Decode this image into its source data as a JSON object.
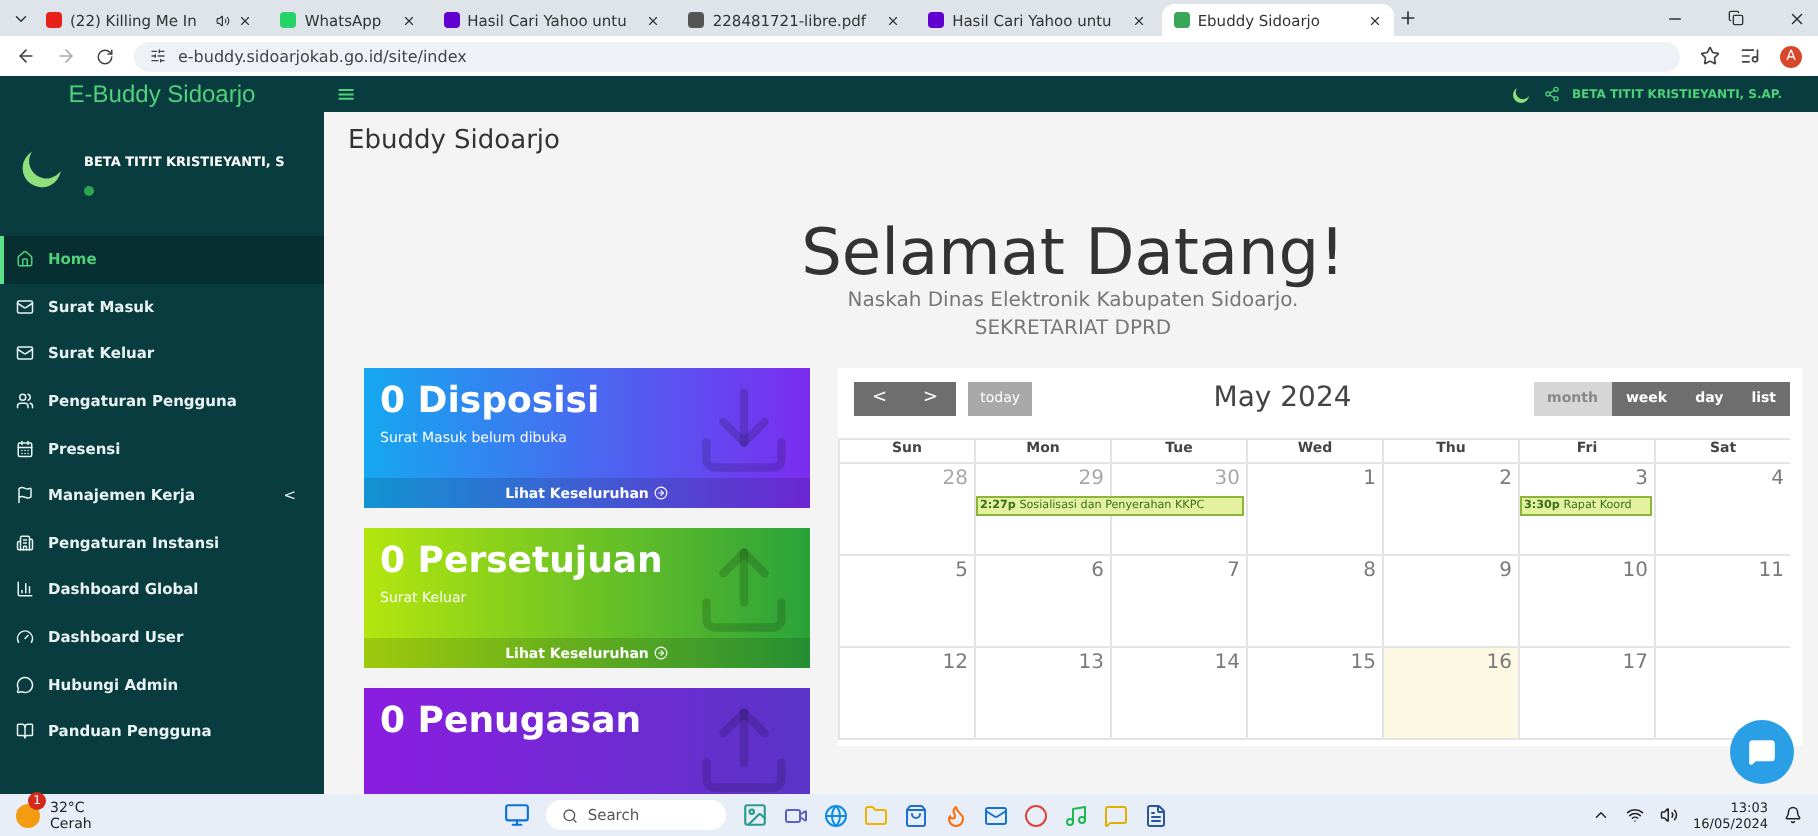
{
  "browser": {
    "tabs": [
      {
        "title": "(22) Killing Me In",
        "selected": false,
        "audio": true
      },
      {
        "title": "WhatsApp",
        "selected": false
      },
      {
        "title": "Hasil Cari Yahoo untu",
        "selected": false
      },
      {
        "title": "228481721-libre.pdf",
        "selected": false
      },
      {
        "title": "Hasil Cari Yahoo untu",
        "selected": false
      },
      {
        "title": "Ebuddy Sidoarjo",
        "selected": true
      }
    ],
    "address": "e-buddy.sidoarjokab.go.id/site/index",
    "profile_initial": "A"
  },
  "header": {
    "brand": "E-Buddy Sidoarjo",
    "menu_glyph": "≡",
    "user": "BETA TITIT KRISTIEYANTI, S.AP."
  },
  "sidebar": {
    "user": "BETA TITIT KRISTIEYANTI, S",
    "items": [
      {
        "label": "Home",
        "selected": true
      },
      {
        "label": "Surat Masuk",
        "selected": false
      },
      {
        "label": "Surat Keluar",
        "selected": false
      },
      {
        "label": "Pengaturan Pengguna",
        "selected": false
      },
      {
        "label": "Presensi",
        "selected": false
      },
      {
        "label": "Manajemen Kerja",
        "selected": false,
        "caret": "<"
      },
      {
        "label": "Pengaturan Instansi",
        "selected": false
      },
      {
        "label": "Dashboard Global",
        "selected": false
      },
      {
        "label": "Dashboard User",
        "selected": false
      },
      {
        "label": "Hubungi Admin",
        "selected": false
      },
      {
        "label": "Panduan Pengguna",
        "selected": false
      }
    ]
  },
  "page_title": "Ebuddy Sidoarjo",
  "welcome": {
    "heading": "Selamat Datang!",
    "subtitle": "Naskah Dinas Elektronik Kabupaten Sidoarjo.",
    "org": "SEKRETARIAT DPRD"
  },
  "cards": [
    {
      "title": "0 Disposisi",
      "subtitle": "Surat Masuk belum dibuka",
      "link": "Lihat Keseluruhan"
    },
    {
      "title": "0 Persetujuan",
      "subtitle": "Surat Keluar",
      "link": "Lihat Keseluruhan"
    },
    {
      "title": "0 Penugasan"
    }
  ],
  "calendar": {
    "prev": "<",
    "next": ">",
    "today": {
      "label": "today",
      "disabled": true
    },
    "title": "May 2024",
    "views": [
      {
        "label": "month",
        "selected": true
      },
      {
        "label": "week",
        "selected": false
      },
      {
        "label": "day",
        "selected": false
      },
      {
        "label": "list",
        "selected": false
      }
    ],
    "weekdays": [
      "Sun",
      "Mon",
      "Tue",
      "Wed",
      "Thu",
      "Fri",
      "Sat"
    ],
    "weeks": [
      [
        {
          "day": "28",
          "other_month": true
        },
        {
          "day": "29",
          "other_month": true,
          "events": [
            {
              "time": "2:27p",
              "title": "Sosialisasi dan Penyerahan KKPC",
              "multi_day": true
            }
          ]
        },
        {
          "day": "30",
          "other_month": true
        },
        {
          "day": "1",
          "other_month": false
        },
        {
          "day": "2",
          "other_month": false
        },
        {
          "day": "3",
          "other_month": false,
          "events": [
            {
              "time": "3:30p",
              "title": "Rapat Koord",
              "multi_day": false
            }
          ]
        },
        {
          "day": "4",
          "other_month": false
        }
      ],
      [
        {
          "day": "5",
          "other_month": false
        },
        {
          "day": "6",
          "other_month": false
        },
        {
          "day": "7",
          "other_month": false
        },
        {
          "day": "8",
          "other_month": false
        },
        {
          "day": "9",
          "other_month": false
        },
        {
          "day": "10",
          "other_month": false
        },
        {
          "day": "11",
          "other_month": false
        }
      ],
      [
        {
          "day": "12",
          "other_month": false
        },
        {
          "day": "13",
          "other_month": false
        },
        {
          "day": "14",
          "other_month": false
        },
        {
          "day": "15",
          "other_month": false
        },
        {
          "day": "16",
          "other_month": false,
          "today": true
        },
        {
          "day": "17",
          "other_month": false
        }
      ]
    ]
  },
  "taskbar": {
    "weather": {
      "temp": "32°C",
      "condition": "Cerah",
      "badge": "1"
    },
    "search": "Search",
    "time": "13:03",
    "date": "16/05/2024"
  }
}
